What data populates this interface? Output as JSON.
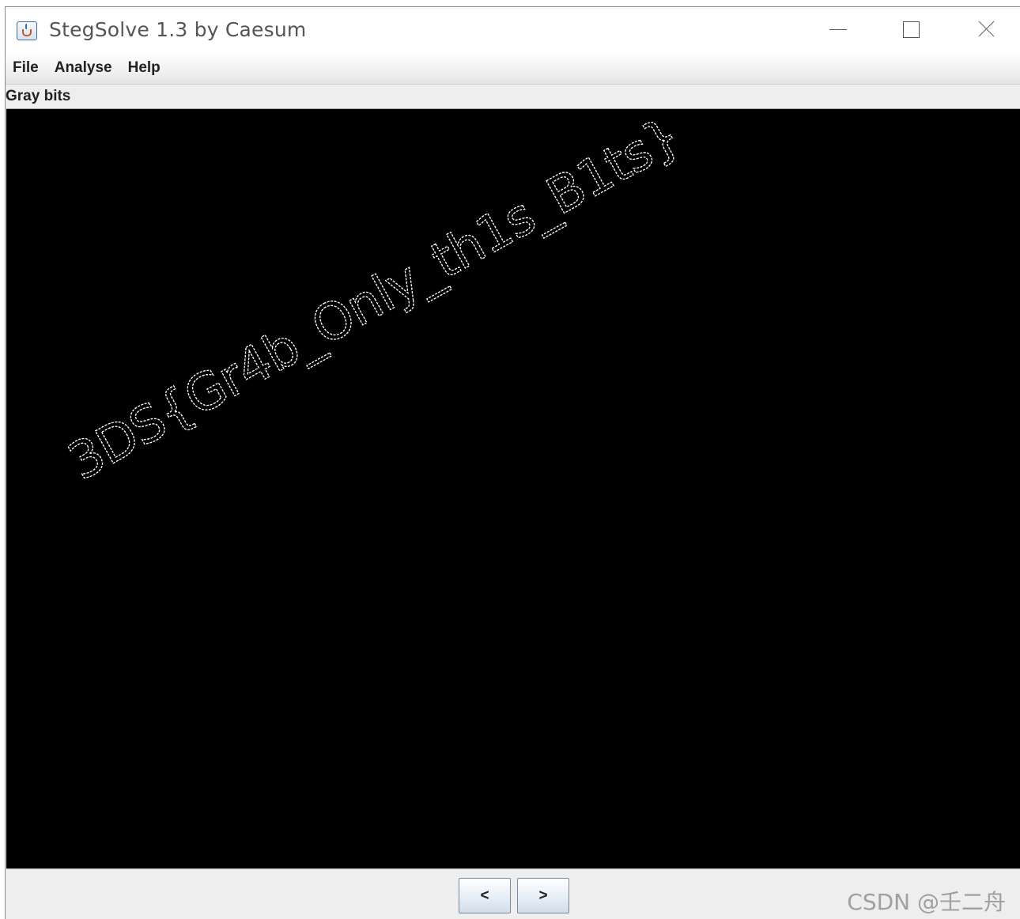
{
  "window": {
    "title": "StegSolve 1.3 by Caesum",
    "app_icon": "java-cup-icon",
    "controls": [
      "minimize-icon",
      "maximize-icon",
      "close-icon"
    ]
  },
  "menu": {
    "items": [
      {
        "label": "File"
      },
      {
        "label": "Analyse"
      },
      {
        "label": "Help"
      }
    ]
  },
  "mode_label": "Gray bits",
  "image": {
    "text": "3DS{Gr4b_Only_th1s_B1ts}",
    "background_color": "#000000",
    "text_color": "#ffffff",
    "style": "outlined edge pixels"
  },
  "navigation": {
    "prev_label": "<",
    "next_label": ">"
  },
  "watermark": "CSDN @壬二舟"
}
